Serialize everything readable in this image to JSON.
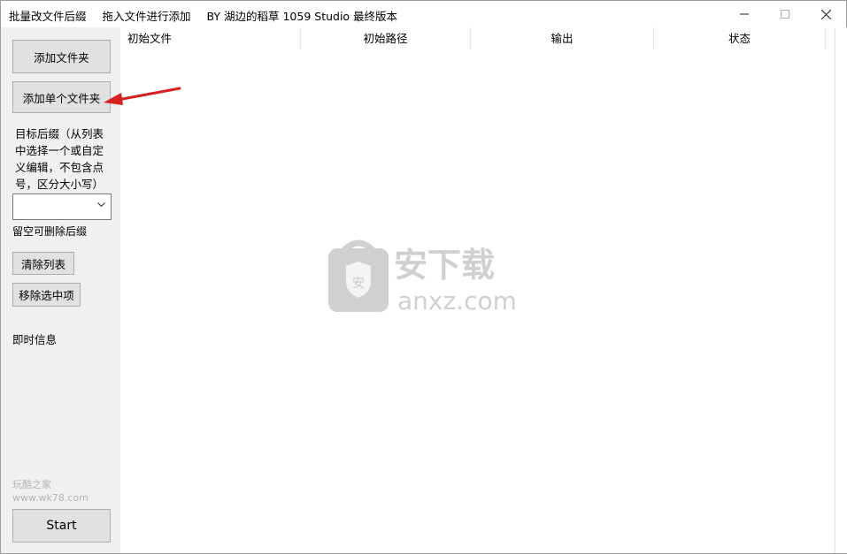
{
  "titlebar": {
    "title_parts": [
      "批量改文件后缀",
      "拖入文件进行添加",
      "BY 湖边的稻草 1059 Studio 最终版本"
    ]
  },
  "sidebar": {
    "add_folder_label": "添加文件夹",
    "add_single_folder_label": "添加单个文件夹",
    "suffix_description": "目标后缀（从列表中选择一个或自定义编辑，不包含点号，区分大小写）",
    "suffix_combo_value": "",
    "suffix_hint": "留空可删除后缀",
    "clear_list_label": "清除列表",
    "remove_selected_label": "移除选中项",
    "info_label": "即时信息",
    "start_label": "Start"
  },
  "listview": {
    "columns": [
      "初始文件",
      "初始路径",
      "输出",
      "状态"
    ],
    "rows": []
  },
  "watermark": {
    "center_cn": "安下载",
    "center_en": "anxz.com",
    "shield_char": "安",
    "bottom_line1": "玩酷之家",
    "bottom_line2": "www.wk78.com"
  },
  "colors": {
    "panel_bg": "#f0f0f0",
    "button_bg": "#e1e1e1",
    "button_border": "#adadad",
    "annotation_arrow": "#d61f1f",
    "watermark_gray": "#d0d0d0"
  },
  "icons": {
    "minimize": "minimize-icon",
    "maximize": "maximize-icon",
    "close": "close-icon",
    "dropdown": "chevron-down-icon",
    "annotation": "red-arrow-icon"
  }
}
